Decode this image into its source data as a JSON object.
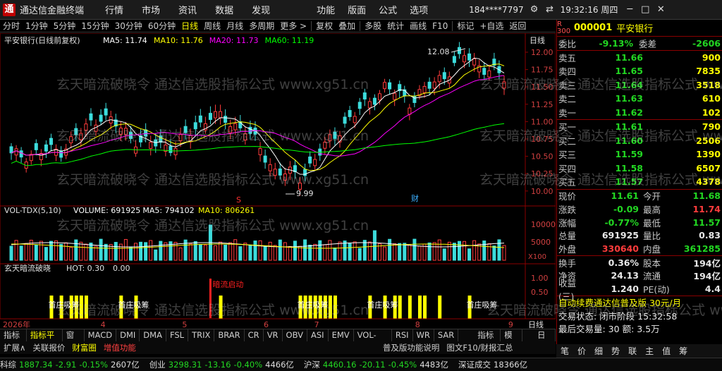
{
  "app": {
    "title": "通达信金融终端",
    "logo": "通"
  },
  "menu": [
    "行情",
    "市场",
    "资讯",
    "数据",
    "发现"
  ],
  "menu_right": [
    "功能",
    "版面",
    "公式",
    "选项"
  ],
  "user": "184****7797",
  "clock": "19:32:16 周四",
  "toolbar": [
    "分时",
    "1分钟",
    "5分钟",
    "15分钟",
    "30分钟",
    "60分钟",
    "日线",
    "周线",
    "月线",
    "多周期",
    "更多 >",
    "复权",
    "叠加",
    "多股",
    "统计",
    "画线",
    "F10",
    "标记",
    "+自选",
    "返回"
  ],
  "toolbar_active": "日线",
  "chart": {
    "header": "平安银行(日线前复权)",
    "ma_labels": [
      {
        "text": "MA5: 11.74",
        "color": "#ffffff"
      },
      {
        "text": "MA10: 11.76",
        "color": "#ffff00"
      },
      {
        "text": "MA20: 11.73",
        "color": "#ff00ff"
      },
      {
        "text": "MA60: 11.19",
        "color": "#00ff00"
      }
    ],
    "price_ticks": [
      "12.00",
      "11.75",
      "11.50",
      "11.25",
      "11.00",
      "10.75",
      "10.50",
      "10.25",
      "10.00"
    ],
    "high_label": "12.08",
    "low_label": "9.99",
    "s_marker": "S",
    "cai_marker": "财",
    "vol_header": "VOL-TDX(5,10)",
    "vol_labels": [
      {
        "text": "VOLUME: 691925",
        "color": "#ffffff"
      },
      {
        "text": "MA5: 794102",
        "color": "#ffffff"
      },
      {
        "text": "MA10: 806261",
        "color": "#ffff00"
      }
    ],
    "vol_ticks": [
      "10000",
      "5000"
    ],
    "vol_unit": "X100",
    "ind_header": "玄天暗流破晓",
    "ind_label": "HOT: 0.30",
    "ind_label2": "0.00",
    "ind_ticks": [
      "1.00",
      "0.50"
    ],
    "ind_signal": "暗流启动",
    "ind_tags": [
      "首庄吸筹",
      "首庄吸筹",
      "首庄吸筹",
      "首庄吸筹",
      "首庄吸筹"
    ],
    "dates": [
      "2026年",
      "4",
      "5",
      "6",
      "7",
      "8",
      "9"
    ]
  },
  "quote": {
    "code": "000001",
    "name": "平安银行",
    "weibi_label": "委比",
    "weibi": "-9.13%",
    "weicha_label": "委差",
    "weicha": "-2606",
    "sell": [
      {
        "label": "卖五",
        "price": "11.66",
        "vol": "900"
      },
      {
        "label": "卖四",
        "price": "11.65",
        "vol": "7835"
      },
      {
        "label": "卖三",
        "price": "11.64",
        "vol": "3518"
      },
      {
        "label": "卖二",
        "price": "11.63",
        "vol": "610"
      },
      {
        "label": "卖一",
        "price": "11.62",
        "vol": "102"
      }
    ],
    "buy": [
      {
        "label": "买一",
        "price": "11.61",
        "vol": "790"
      },
      {
        "label": "买二",
        "price": "11.60",
        "vol": "2506"
      },
      {
        "label": "买三",
        "price": "11.59",
        "vol": "1390"
      },
      {
        "label": "买四",
        "price": "11.58",
        "vol": "6507"
      },
      {
        "label": "买五",
        "price": "11.57",
        "vol": "4378"
      }
    ],
    "stats": [
      {
        "l1": "现价",
        "v1": "11.61",
        "c1": "g",
        "l2": "今开",
        "v2": "11.68",
        "c2": "g"
      },
      {
        "l1": "涨跌",
        "v1": "-0.09",
        "c1": "g",
        "l2": "最高",
        "v2": "11.74",
        "c2": "r"
      },
      {
        "l1": "涨幅",
        "v1": "-0.77%",
        "c1": "g",
        "l2": "最低",
        "v2": "11.57",
        "c2": "g"
      },
      {
        "l1": "总量",
        "v1": "691925",
        "c1": "w",
        "l2": "量比",
        "v2": "0.83",
        "c2": "w"
      },
      {
        "l1": "外盘",
        "v1": "330640",
        "c1": "r",
        "l2": "内盘",
        "v2": "361285",
        "c2": "g"
      }
    ],
    "stats2": [
      {
        "l1": "换手",
        "v1": "0.36%",
        "l2": "股本",
        "v2": "194亿"
      },
      {
        "l1": "净资",
        "v1": "24.13",
        "l2": "流通",
        "v2": "194亿"
      },
      {
        "l1": "收益(三)",
        "v1": "1.240",
        "l2": "PE(动)",
        "v2": "4.4"
      }
    ],
    "promo": "自动续费通达信普及版 30元/月",
    "trade_status": "交易状态: 闭市阶段  15:32:58",
    "last_trade": "最后交易量: 30  额: 3.5万",
    "bottom_tabs": [
      "笔",
      "价",
      "细",
      "势",
      "联",
      "主",
      "值",
      "筹"
    ]
  },
  "tabs1": [
    "指标A",
    "指标平台",
    "窗口",
    "MACD",
    "DMI",
    "DMA",
    "FSL",
    "TRIX",
    "BRAR",
    "CR",
    "VR",
    "OBV",
    "ASI",
    "EMV",
    "VOL-TDX",
    "RSI",
    "WR",
    "SAR",
    "指标B",
    "模板",
    "日线"
  ],
  "tabs1_active": "指标平台",
  "tabs2": [
    "扩展∧",
    "关联报价",
    "财富圈",
    "增值功能",
    "普及版功能说明",
    "图文F10/财报汇总"
  ],
  "status": [
    {
      "label": "科综",
      "value": "1887.34",
      "chg": "-2.91",
      "pct": "-0.15%",
      "amt": "2607亿"
    },
    {
      "label": "创业",
      "value": "3298.31",
      "chg": "-13.16",
      "pct": "-0.40%",
      "amt": "4466亿"
    },
    {
      "label": "沪深",
      "value": "4460.16",
      "chg": "-20.11",
      "pct": "-0.45%",
      "amt": "4483亿"
    },
    {
      "label": "深证成交",
      "value": "",
      "chg": "",
      "pct": "",
      "amt": "18366亿"
    }
  ],
  "watermark": "玄天暗流破晓令 通达信选股指标公式 www.xg51.cn"
}
